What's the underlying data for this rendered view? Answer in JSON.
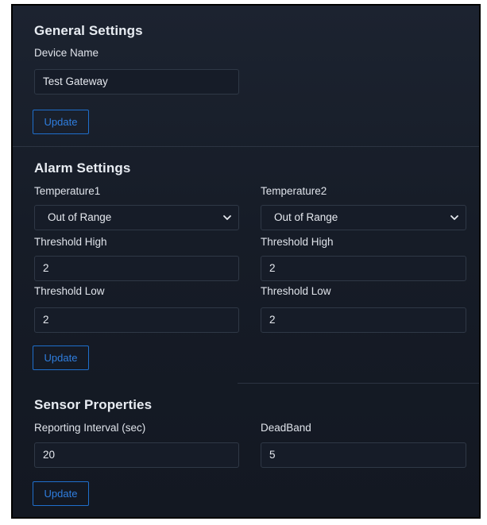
{
  "general": {
    "title": "General Settings",
    "device_name_label": "Device Name",
    "device_name_value": "Test Gateway",
    "update_label": "Update"
  },
  "alarm": {
    "title": "Alarm Settings",
    "temp1": {
      "label": "Temperature1",
      "mode": "Out of Range",
      "threshold_high_label": "Threshold High",
      "threshold_high_value": "2",
      "threshold_low_label": "Threshold Low",
      "threshold_low_value": "2"
    },
    "temp2": {
      "label": "Temperature2",
      "mode": "Out of Range",
      "threshold_high_label": "Threshold High",
      "threshold_high_value": "2",
      "threshold_low_label": "Threshold Low",
      "threshold_low_value": "2"
    },
    "update_label": "Update"
  },
  "sensor": {
    "title": "Sensor Properties",
    "interval_label": "Reporting Interval (sec)",
    "interval_value": "20",
    "deadband_label": "DeadBand",
    "deadband_value": "5",
    "update_label": "Update"
  },
  "colors": {
    "accent": "#1f6fcc",
    "panel_bg": "#1a212d",
    "field_bg": "#161c28"
  },
  "icons": {
    "select_chevron": "chevron-down-icon"
  }
}
